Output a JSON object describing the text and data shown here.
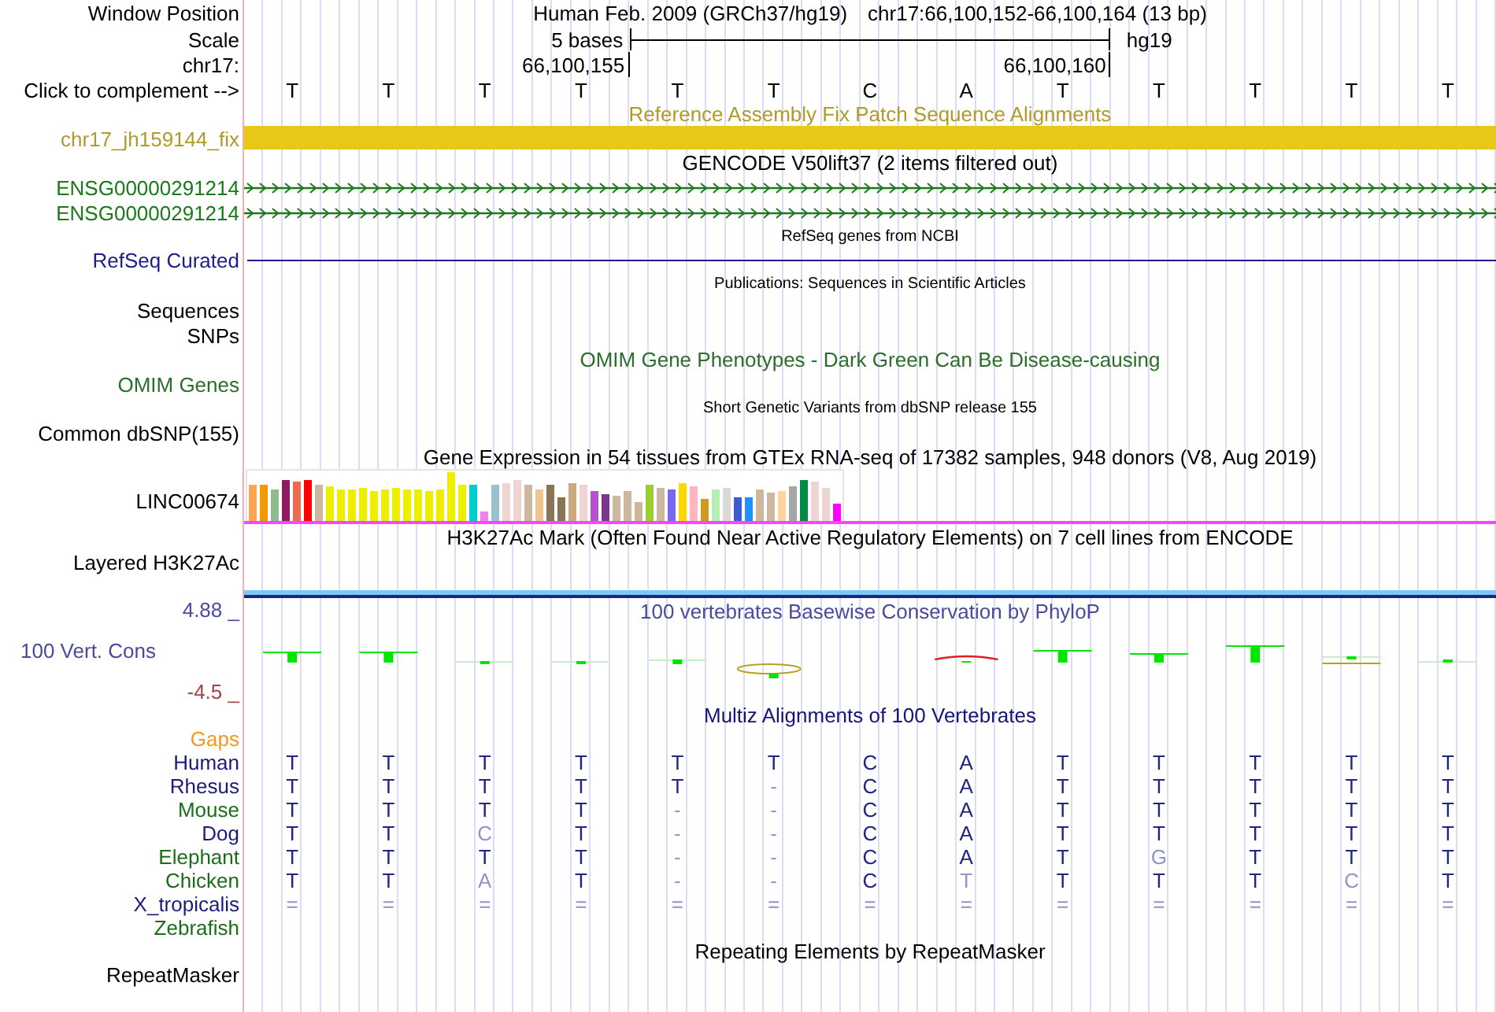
{
  "position": {
    "label": "Window Position",
    "assembly": "Human Feb. 2009 (GRCh37/hg19)",
    "range": "chr17:66,100,152-66,100,164 (13 bp)"
  },
  "scale": {
    "label": "Scale",
    "length": "5 bases",
    "database": "hg19"
  },
  "ruler": {
    "label": "chr17:",
    "start": "66,100,155",
    "end": "66,100,160"
  },
  "sequence": {
    "label": "Click to complement -->",
    "bases": [
      "T",
      "T",
      "T",
      "T",
      "T",
      "T",
      "C",
      "A",
      "T",
      "T",
      "T",
      "T",
      "T"
    ]
  },
  "tracks": [
    {
      "kind": "patch",
      "title": "Reference Assembly Fix Patch Sequence Alignments",
      "color": "#b09a28",
      "rows": [
        {
          "label": "chr17_jh159144_fix"
        }
      ]
    },
    {
      "kind": "genes",
      "title": "GENCODE V50lift37 (2 items filtered out)",
      "color": "#1a7a1a",
      "rows": [
        {
          "label": "ENSG00000291214"
        },
        {
          "label": "ENSG00000291214"
        }
      ]
    },
    {
      "kind": "refseq",
      "title": "RefSeq genes from NCBI",
      "color": "#1c1c8a",
      "rows": [
        {
          "label": "RefSeq Curated"
        }
      ]
    },
    {
      "kind": "publications",
      "title": "Publications: Sequences in Scientific Articles",
      "color": "#000000",
      "rows": [
        {
          "label": "Sequences"
        },
        {
          "label": "SNPs"
        }
      ]
    },
    {
      "kind": "omim",
      "title": "OMIM Gene Phenotypes - Dark Green Can Be Disease-causing",
      "color": "#2a6e2a",
      "rows": [
        {
          "label": "OMIM Genes"
        }
      ]
    },
    {
      "kind": "variants",
      "title": "Short Genetic Variants from dbSNP release 155",
      "color": "#000000",
      "rows": [
        {
          "label": "Common dbSNP(155)"
        }
      ]
    },
    {
      "kind": "expression",
      "title": "Gene Expression in 54 tissues from GTEx RNA-seq of 17382 samples, 948 donors (V8, Aug 2019)",
      "color": "#000000",
      "rows": [
        {
          "label": "LINC00674"
        }
      ]
    },
    {
      "kind": "signal",
      "title": "H3K27Ac Mark (Often Found Near Active Regulatory Elements) on 7 cell lines from ENCODE",
      "color": "#000000",
      "rows": [
        {
          "label": "Layered H3K27Ac"
        }
      ]
    },
    {
      "kind": "conservation",
      "title": "100 vertebrates Basewise Conservation by PhyloP",
      "color": "#4a4a9c",
      "rows": [
        {
          "label": "100 Vert. Cons",
          "max": "4.88 _",
          "min": "-4.5 _"
        }
      ]
    },
    {
      "kind": "alignment",
      "title": "Multiz Alignments of 100 Vertebrates",
      "color": "#141478",
      "rows": [
        {
          "label": "Gaps",
          "color": "#f5961e"
        },
        {
          "label": "Human",
          "color": "#1c1c78",
          "bases": [
            {
              "text": "T",
              "match": true
            },
            {
              "text": "T",
              "match": true
            },
            {
              "text": "T",
              "match": true
            },
            {
              "text": "T",
              "match": true
            },
            {
              "text": "T",
              "match": true
            },
            {
              "text": "T",
              "match": true
            },
            {
              "text": "C",
              "match": true
            },
            {
              "text": "A",
              "match": true
            },
            {
              "text": "T",
              "match": true
            },
            {
              "text": "T",
              "match": true
            },
            {
              "text": "T",
              "match": true
            },
            {
              "text": "T",
              "match": true
            },
            {
              "text": "T",
              "match": true
            }
          ]
        },
        {
          "label": "Rhesus",
          "color": "#1c1c78",
          "bases": [
            {
              "text": "T",
              "match": true
            },
            {
              "text": "T",
              "match": true
            },
            {
              "text": "T",
              "match": true
            },
            {
              "text": "T",
              "match": true
            },
            {
              "text": "T",
              "match": true
            },
            {
              "text": "-",
              "match": false
            },
            {
              "text": "C",
              "match": true
            },
            {
              "text": "A",
              "match": true
            },
            {
              "text": "T",
              "match": true
            },
            {
              "text": "T",
              "match": true
            },
            {
              "text": "T",
              "match": true
            },
            {
              "text": "T",
              "match": true
            },
            {
              "text": "T",
              "match": true
            }
          ]
        },
        {
          "label": "Mouse",
          "color": "#1a6e1a",
          "bases": [
            {
              "text": "T",
              "match": true
            },
            {
              "text": "T",
              "match": true
            },
            {
              "text": "T",
              "match": true
            },
            {
              "text": "T",
              "match": true
            },
            {
              "text": "-",
              "match": false
            },
            {
              "text": "-",
              "match": false
            },
            {
              "text": "C",
              "match": true
            },
            {
              "text": "A",
              "match": true
            },
            {
              "text": "T",
              "match": true
            },
            {
              "text": "T",
              "match": true
            },
            {
              "text": "T",
              "match": true
            },
            {
              "text": "T",
              "match": true
            },
            {
              "text": "T",
              "match": true
            }
          ]
        },
        {
          "label": "Dog",
          "color": "#1c1c78",
          "bases": [
            {
              "text": "T",
              "match": true
            },
            {
              "text": "T",
              "match": true
            },
            {
              "text": "C",
              "match": false
            },
            {
              "text": "T",
              "match": true
            },
            {
              "text": "-",
              "match": false
            },
            {
              "text": "-",
              "match": false
            },
            {
              "text": "C",
              "match": true
            },
            {
              "text": "A",
              "match": true
            },
            {
              "text": "T",
              "match": true
            },
            {
              "text": "T",
              "match": true
            },
            {
              "text": "T",
              "match": true
            },
            {
              "text": "T",
              "match": true
            },
            {
              "text": "T",
              "match": true
            }
          ]
        },
        {
          "label": "Elephant",
          "color": "#1a6e1a",
          "bases": [
            {
              "text": "T",
              "match": true
            },
            {
              "text": "T",
              "match": true
            },
            {
              "text": "T",
              "match": true
            },
            {
              "text": "T",
              "match": true
            },
            {
              "text": "-",
              "match": false
            },
            {
              "text": "-",
              "match": false
            },
            {
              "text": "C",
              "match": true
            },
            {
              "text": "A",
              "match": true
            },
            {
              "text": "T",
              "match": true
            },
            {
              "text": "G",
              "match": false
            },
            {
              "text": "T",
              "match": true
            },
            {
              "text": "T",
              "match": true
            },
            {
              "text": "T",
              "match": true
            }
          ]
        },
        {
          "label": "Chicken",
          "color": "#1a6e1a",
          "bases": [
            {
              "text": "T",
              "match": true
            },
            {
              "text": "T",
              "match": true
            },
            {
              "text": "A",
              "match": false
            },
            {
              "text": "T",
              "match": true
            },
            {
              "text": "-",
              "match": false
            },
            {
              "text": "-",
              "match": false
            },
            {
              "text": "C",
              "match": true
            },
            {
              "text": "T",
              "match": false
            },
            {
              "text": "T",
              "match": true
            },
            {
              "text": "T",
              "match": true
            },
            {
              "text": "T",
              "match": true
            },
            {
              "text": "C",
              "match": false
            },
            {
              "text": "T",
              "match": true
            }
          ]
        },
        {
          "label": "X_tropicalis",
          "color": "#1c1c78",
          "bases": [
            {
              "text": "=",
              "match": false
            },
            {
              "text": "=",
              "match": false
            },
            {
              "text": "=",
              "match": false
            },
            {
              "text": "=",
              "match": false
            },
            {
              "text": "=",
              "match": false
            },
            {
              "text": "=",
              "match": false
            },
            {
              "text": "=",
              "match": false
            },
            {
              "text": "=",
              "match": false
            },
            {
              "text": "=",
              "match": false
            },
            {
              "text": "=",
              "match": false
            },
            {
              "text": "=",
              "match": false
            },
            {
              "text": "=",
              "match": false
            },
            {
              "text": "=",
              "match": false
            }
          ]
        },
        {
          "label": "Zebrafish",
          "color": "#1a6e1a"
        }
      ]
    },
    {
      "kind": "repeats",
      "title": "Repeating Elements by RepeatMasker",
      "color": "#000000",
      "rows": [
        {
          "label": "RepeatMasker"
        }
      ]
    }
  ]
}
